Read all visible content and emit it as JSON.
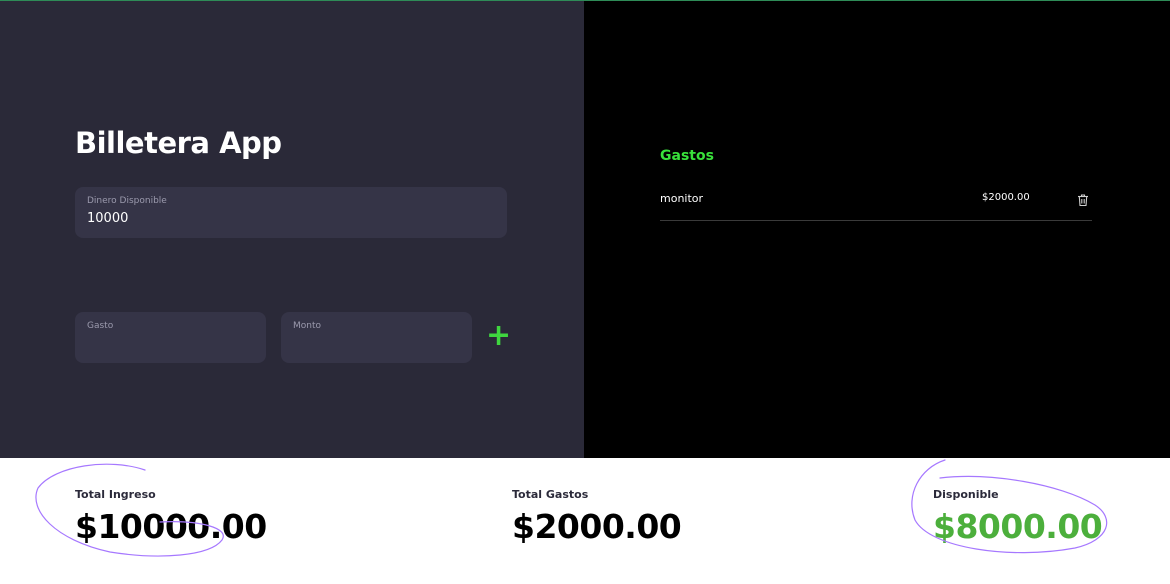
{
  "app": {
    "title": "Billetera App"
  },
  "form": {
    "available": {
      "label": "Dinero Disponible",
      "value": "10000"
    },
    "expense_name": {
      "label": "Gasto",
      "value": ""
    },
    "expense_amount": {
      "label": "Monto",
      "value": ""
    },
    "add_symbol": "+"
  },
  "expenses": {
    "title": "Gastos",
    "items": [
      {
        "name": "monitor",
        "amount": "$2000.00"
      }
    ]
  },
  "summary": {
    "income": {
      "label": "Total Ingreso",
      "value": "$10000.00"
    },
    "expenses": {
      "label": "Total Gastos",
      "value": "$2000.00"
    },
    "available": {
      "label": "Disponible",
      "value": "$8000.00"
    }
  },
  "colors": {
    "accent": "#39e13b",
    "available_value": "#4caf3c",
    "left_bg": "#2a2938",
    "field_bg": "#353447",
    "annotation": "#a678ff"
  }
}
